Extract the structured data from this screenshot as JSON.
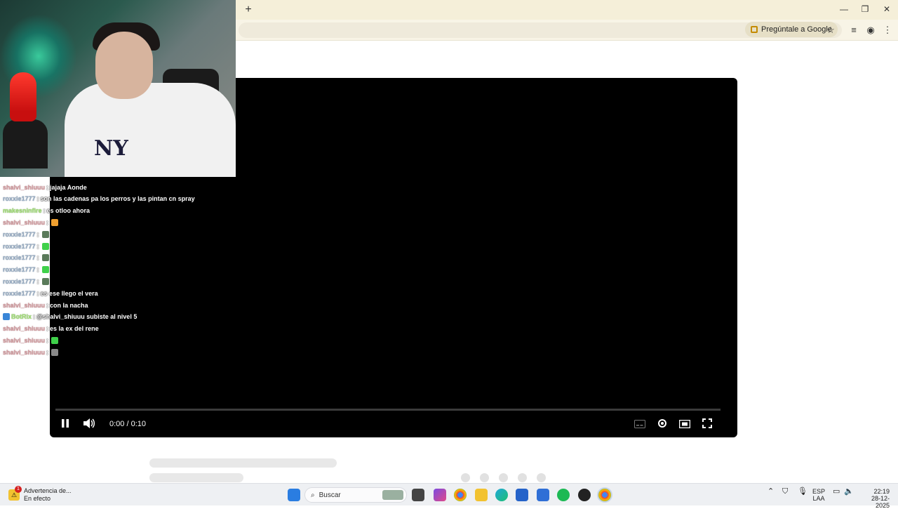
{
  "browser": {
    "newtab_glyph": "+",
    "window": {
      "minimize": "—",
      "restore": "❐",
      "close": "✕"
    },
    "ask_google_label": "Pregúntale a Google"
  },
  "player": {
    "time": "0:00 / 0:10",
    "progress": 0.0
  },
  "chat": [
    {
      "nick": "shalvi_shiuuu",
      "color": "pink",
      "text": "jajaja Aonde"
    },
    {
      "nick": "roxxie1777",
      "color": "blue",
      "text": "son las cadenas pa los perros y las pintan cn spray"
    },
    {
      "nick": "makesninfire",
      "color": "green",
      "text": "es otloo ahora"
    },
    {
      "nick": "shalvi_shiuuu",
      "color": "pink",
      "text": "",
      "emote": "#f0a030"
    },
    {
      "nick": "roxxie1777",
      "color": "blue",
      "text": "",
      "emote": "#5a7a5a"
    },
    {
      "nick": "roxxie1777",
      "color": "blue",
      "text": "",
      "emote": "#3fd04a"
    },
    {
      "nick": "roxxie1777",
      "color": "blue",
      "text": "",
      "emote": "#5a7a5a"
    },
    {
      "nick": "roxxie1777",
      "color": "blue",
      "text": "",
      "emote": "#3fd04a"
    },
    {
      "nick": "roxxie1777",
      "color": "blue",
      "text": "",
      "emote": "#5a7a5a"
    },
    {
      "nick": "roxxie1777",
      "color": "blue",
      "text": "es ese llego el vera"
    },
    {
      "nick": "shalvi_shiuuu",
      "color": "pink",
      "text": "con la nacha"
    },
    {
      "nick": "BotRix",
      "color": "green",
      "text": "@shalvi_shiuuu subiste al nivel 5"
    },
    {
      "nick": "shalvi_shiuuu",
      "color": "pink",
      "text": "es la ex del rene"
    },
    {
      "nick": "shalvi_shiuuu",
      "color": "pink",
      "text": "",
      "emote": "#3fd04a"
    },
    {
      "nick": "shalvi_shiuuu",
      "color": "pink",
      "text": "",
      "emote": "#8a8a8a"
    }
  ],
  "taskbar": {
    "notification_title": "Advertencia de...",
    "notification_sub": "En efecto",
    "notification_badge": "1",
    "search_placeholder": "Buscar",
    "lang_top": "ESP",
    "lang_bottom": "LAA",
    "time": "22:19",
    "date": "28-12-2025"
  }
}
